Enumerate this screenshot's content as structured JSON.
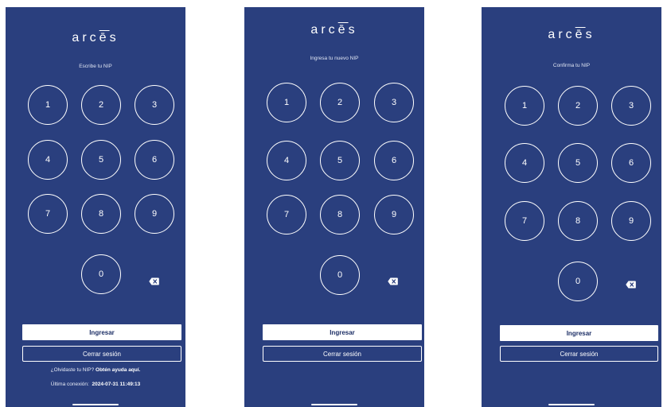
{
  "colors": {
    "background": "#2a3f7e",
    "foreground": "#ffffff",
    "button_text": "#1d2f66"
  },
  "brand": {
    "prefix": "arc",
    "macron_letter": "ē",
    "suffix": "s"
  },
  "keypad": {
    "digits": [
      "1",
      "2",
      "3",
      "4",
      "5",
      "6",
      "7",
      "8",
      "9",
      "0"
    ],
    "backspace_icon": "backspace-icon"
  },
  "screens": [
    {
      "prompt": "Escribe tu NIP",
      "primary_button": "Ingresar",
      "secondary_button": "Cerrar sesión",
      "help_question": "¿Olvidaste tu NIP?",
      "help_link": "Obtén ayuda aquí.",
      "last_connection_label": "Última conexión:",
      "last_connection_value": "2024-07-31 11:49:13"
    },
    {
      "prompt": "Ingresa tu nuevo NIP",
      "primary_button": "Ingresar",
      "secondary_button": "Cerrar sesión"
    },
    {
      "prompt": "Confirma tu NIP",
      "primary_button": "Ingresar",
      "secondary_button": "Cerrar sesión"
    }
  ]
}
